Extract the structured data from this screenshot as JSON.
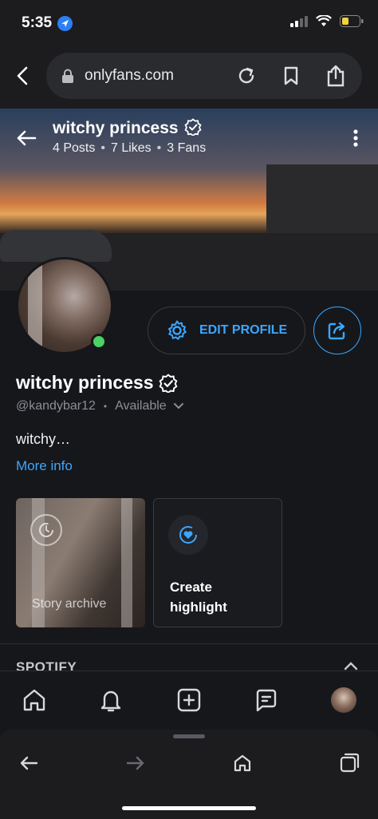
{
  "status": {
    "time": "5:35"
  },
  "browser": {
    "url": "onlyfans.com"
  },
  "profile": {
    "cover_title": "witchy princess",
    "stats": {
      "posts": "4 Posts",
      "likes": "7 Likes",
      "fans": "3 Fans",
      "separator": "•"
    },
    "name": "witchy princess",
    "handle": "@kandybar12",
    "availability": "Available",
    "bio": "witchy…",
    "more_info": "More info",
    "edit_label": "EDIT PROFILE"
  },
  "highlights": {
    "story_label": "Story archive",
    "create_label": "Create highlight"
  },
  "sections": {
    "spotify": "SPOTIFY"
  },
  "colors": {
    "accent": "#3ba7ff",
    "online": "#4ad264",
    "background": "#16171b"
  },
  "icons": [
    "back-icon",
    "lock-icon",
    "reload-icon",
    "bookmark-icon",
    "share-icon",
    "verified-icon",
    "more-icon",
    "gear-icon",
    "chevron-down-icon",
    "history-icon",
    "heart-icon",
    "home-icon",
    "bell-icon",
    "plus-square-icon",
    "message-icon",
    "forward-icon",
    "tabs-icon"
  ]
}
